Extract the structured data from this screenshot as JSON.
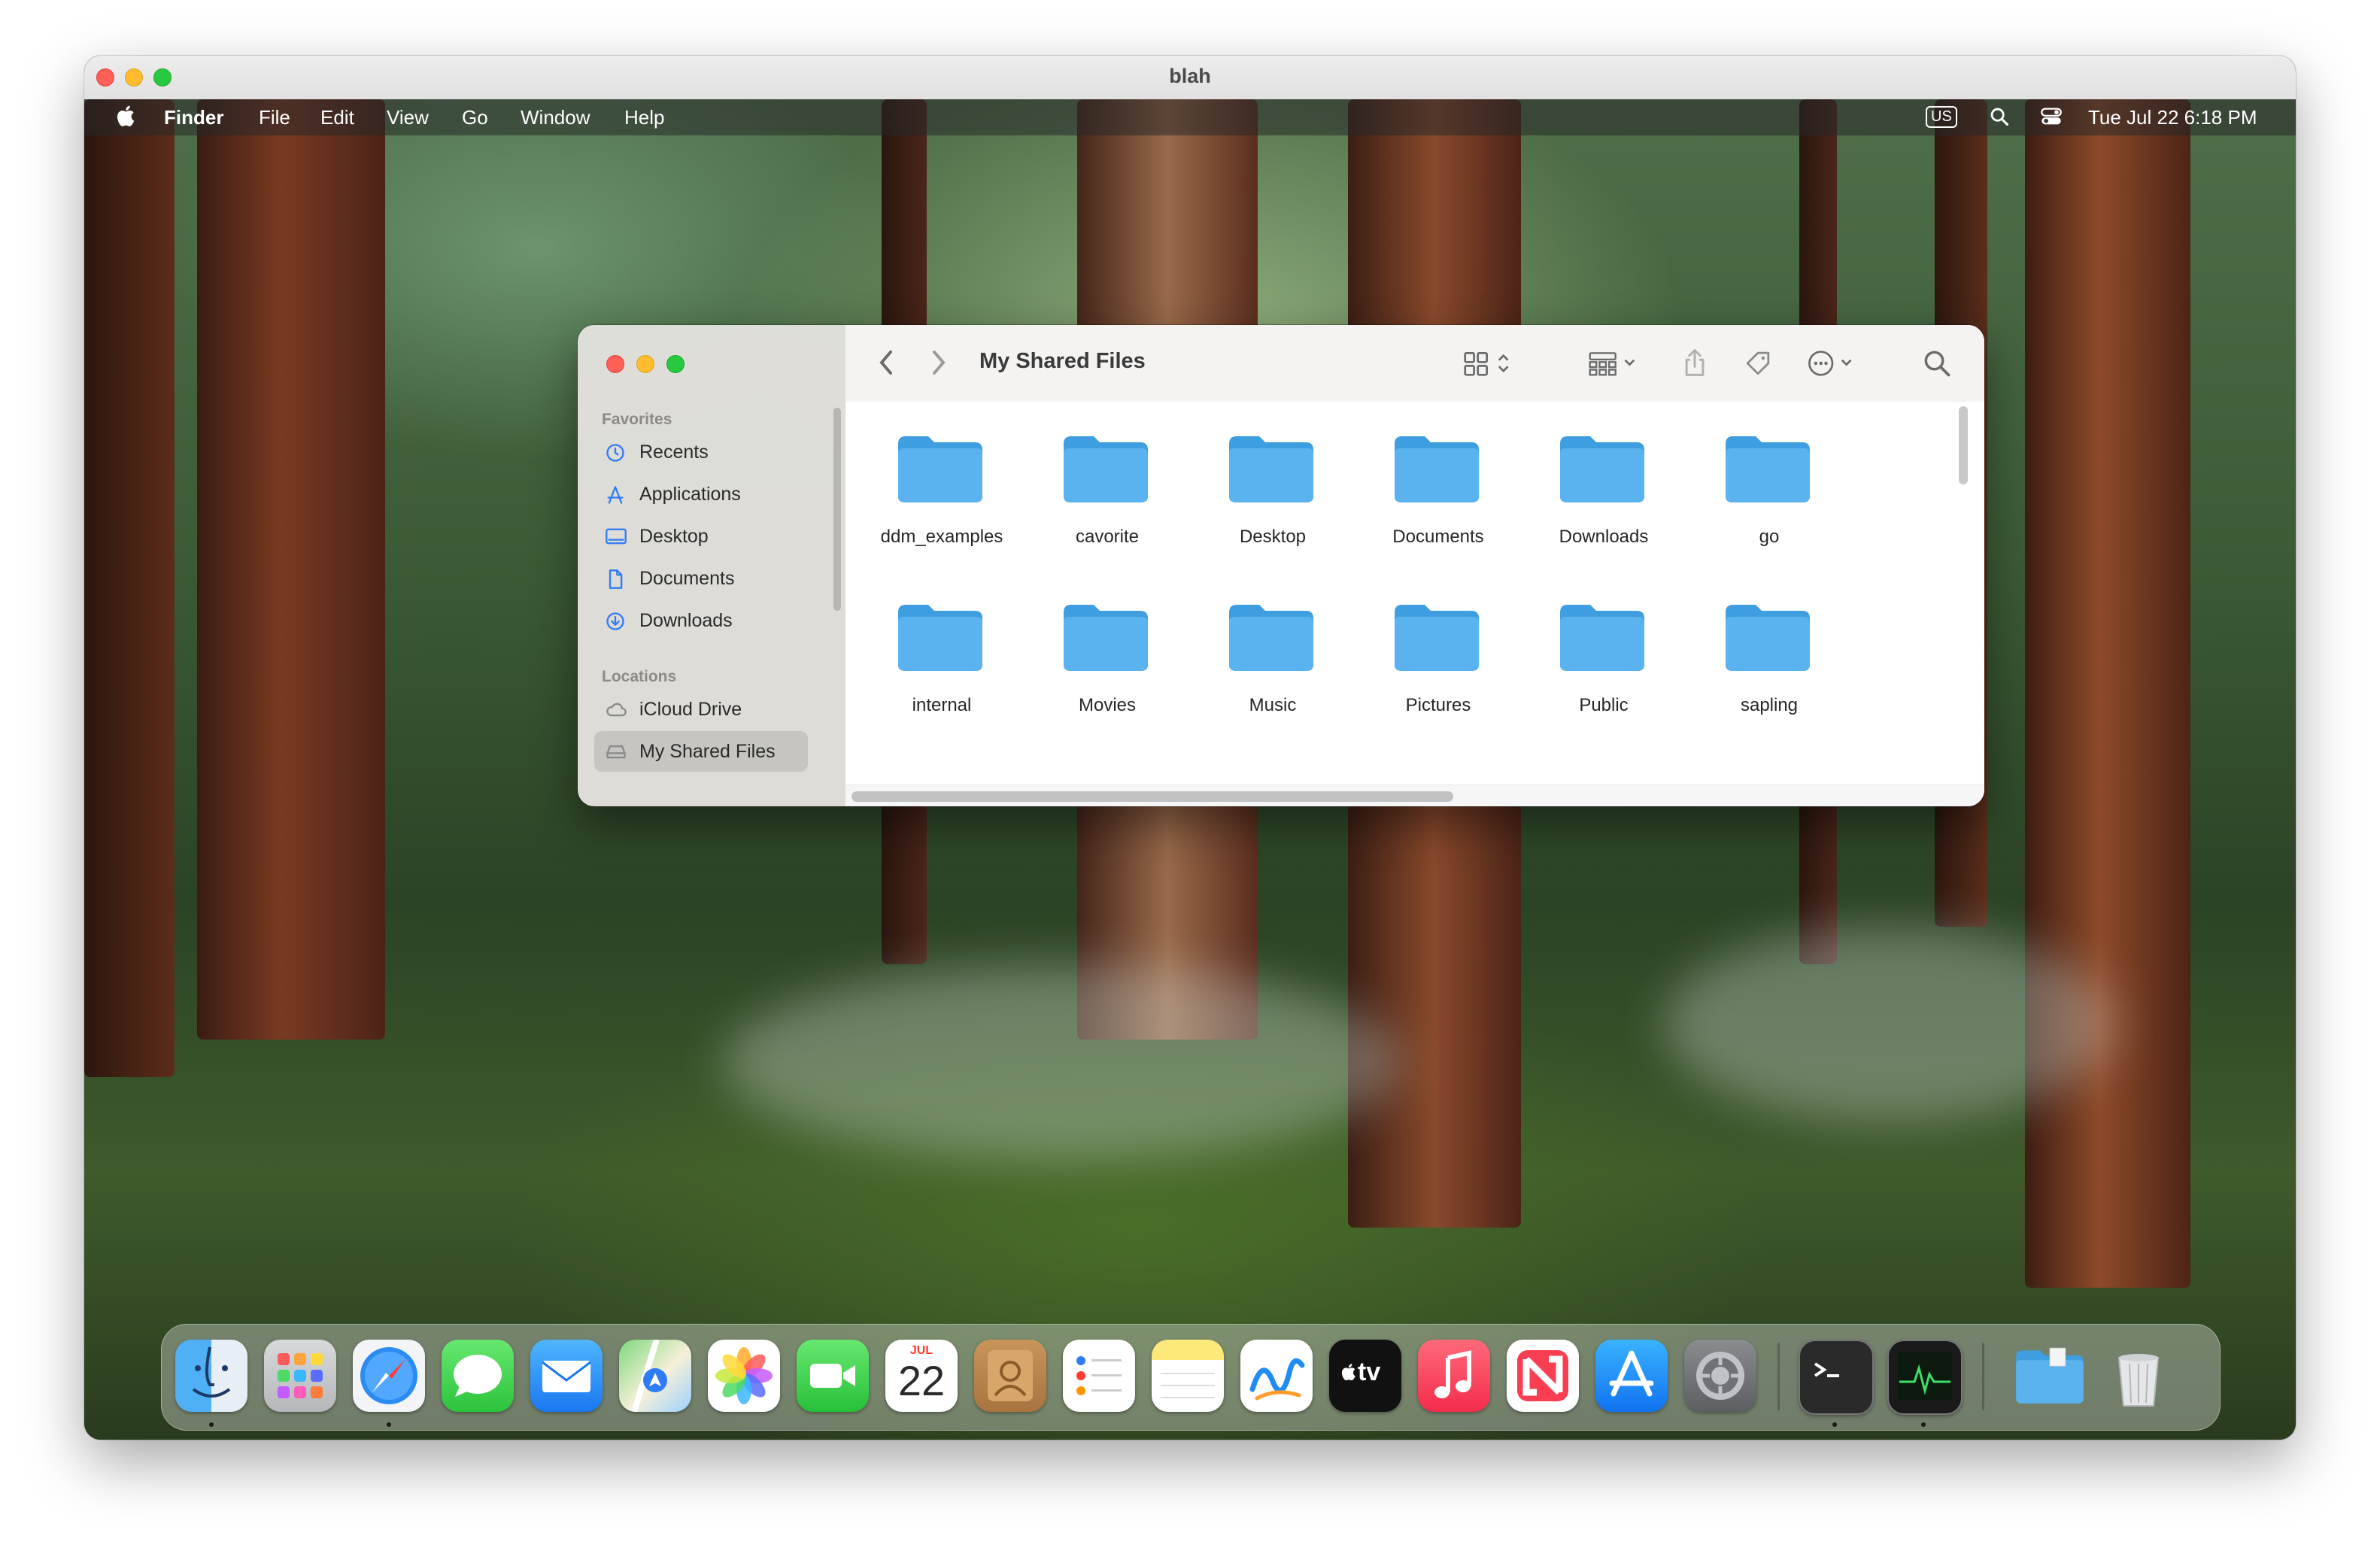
{
  "vm": {
    "title": "blah"
  },
  "menubar": {
    "app": "Finder",
    "items": [
      "File",
      "Edit",
      "View",
      "Go",
      "Window",
      "Help"
    ],
    "input_source": "US",
    "datetime": "Tue Jul 22  6:18 PM"
  },
  "finder": {
    "title": "My Shared Files",
    "sidebar": {
      "favorites_header": "Favorites",
      "favorites": [
        {
          "label": "Recents",
          "icon": "clock-icon"
        },
        {
          "label": "Applications",
          "icon": "applications-icon"
        },
        {
          "label": "Desktop",
          "icon": "desktop-icon"
        },
        {
          "label": "Documents",
          "icon": "document-icon"
        },
        {
          "label": "Downloads",
          "icon": "download-icon"
        }
      ],
      "locations_header": "Locations",
      "locations": [
        {
          "label": "iCloud Drive",
          "icon": "cloud-icon"
        },
        {
          "label": "My Shared Files",
          "icon": "drive-icon",
          "selected": true
        }
      ]
    },
    "folders": [
      "ddm_examples",
      "cavorite",
      "Desktop",
      "Documents",
      "Downloads",
      "go",
      "internal",
      "Movies",
      "Music",
      "Pictures",
      "Public",
      "sapling"
    ]
  },
  "dock": {
    "calendar_month": "JUL",
    "calendar_day": "22",
    "tv_label": "tv",
    "apps": [
      "finder",
      "launchpad",
      "safari",
      "messages",
      "mail",
      "maps",
      "photos",
      "facetime",
      "calendar",
      "contacts",
      "reminders",
      "notes",
      "freeform",
      "tv",
      "music",
      "news",
      "app-store",
      "system-settings",
      "terminal",
      "activity-monitor",
      "downloads-folder",
      "trash"
    ]
  },
  "colors": {
    "folder": "#5ab3ef",
    "accent": "#2f7bf6"
  }
}
